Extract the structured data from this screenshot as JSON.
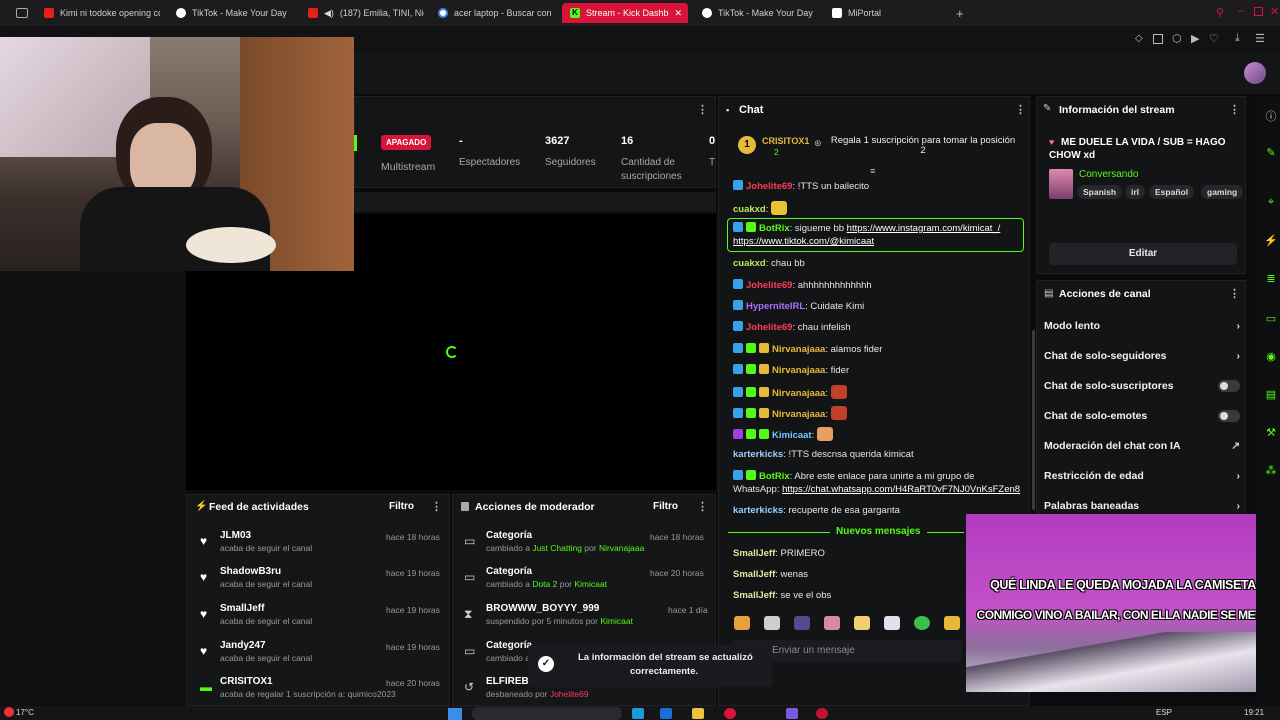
{
  "browser": {
    "tabs": [
      {
        "label": "Kimi ni todoke opening co",
        "icon": "youtube-icon",
        "color": "#e62117"
      },
      {
        "label": "TikTok - Make Your Day",
        "icon": "tiktok-icon",
        "color": "#ffffff"
      },
      {
        "label": "(187) Emilia, TINI, Nic",
        "icon": "youtube-icon",
        "color": "#e62117"
      },
      {
        "label": "acer laptop - Buscar con",
        "icon": "google-icon",
        "color": "#4285f4"
      },
      {
        "label": "Stream - Kick Dashb",
        "icon": "kick-icon",
        "color": "#53fc18",
        "active": true
      },
      {
        "label": "TikTok - Make Your Day",
        "icon": "tiktok-icon",
        "color": "#ffffff"
      },
      {
        "label": "MiPortal",
        "icon": "portal-icon",
        "color": "#ffffff"
      }
    ],
    "new_tab": "+"
  },
  "stats": {
    "status_badge": "APAGADO",
    "multistream": "Multistream",
    "viewers_value": "-",
    "viewers_label": "Espectadores",
    "followers_value": "3627",
    "followers_label": "Seguidores",
    "subs_value": "16",
    "subs_label_1": "Cantidad de",
    "subs_label_2": "suscripciones",
    "extra_value": "0",
    "extra_label": "T"
  },
  "chat": {
    "title": "Chat",
    "pinned_user": "CRISITOX1",
    "pinned_count": "2",
    "pinned_text": "Regala 1 suscripción para tomar la posición 2",
    "pinned_rank": "1",
    "messages": [
      {
        "user": "Johelite69",
        "color": "#ff3b5c",
        "text": ": !TTS un bailecito"
      },
      {
        "user": "cuakxd",
        "color": "#b9e85c",
        "text": ":"
      },
      {
        "user": "BotRix",
        "color": "#53fc18",
        "text": ": sigueme bb ",
        "link": "https://www.instagram.com/kimicat_/"
      },
      {
        "user": "",
        "color": "#ffffff",
        "text": "",
        "link": "https://www.tiktok.com/@kimicaat"
      },
      {
        "user": "cuakxd",
        "color": "#b9e85c",
        "text": ": chau bb"
      },
      {
        "user": "Johelite69",
        "color": "#ff3b5c",
        "text": ": ahhhhhhhhhhhhh"
      },
      {
        "user": "HyperniteIRL",
        "color": "#a970ff",
        "text": ": Cuidate Kimi"
      },
      {
        "user": "Johelite69",
        "color": "#ff3b5c",
        "text": ": chau infelish"
      },
      {
        "user": "Nirvanajaaa",
        "color": "#e6b93a",
        "text": ": alamos fider"
      },
      {
        "user": "Nirvanajaaa",
        "color": "#e6b93a",
        "text": ": fider"
      },
      {
        "user": "Nirvanajaaa",
        "color": "#e6b93a",
        "text": ":"
      },
      {
        "user": "Nirvanajaaa",
        "color": "#e6b93a",
        "text": ":"
      },
      {
        "user": "Kimicaat",
        "color": "#6ec6ff",
        "text": ":"
      },
      {
        "user": "karterkicks",
        "color": "#9ad0ff",
        "text": ": !TTS descnsa querida kimicat"
      },
      {
        "user": "BotRix",
        "color": "#53fc18",
        "text": ": Abre este enlace para unirte a mi grupo de"
      },
      {
        "user": "",
        "color": "#ffffff",
        "text": "WhatsApp: ",
        "link": "https://chat.whatsapp.com/H4RaRT0vF7NJ0VnKsFZen8"
      },
      {
        "user": "karterkicks",
        "color": "#9ad0ff",
        "text": ": recuperte de esa garganta"
      }
    ],
    "new_messages": "Nuevos mensajes",
    "new": [
      {
        "user": "SmallJeff",
        "color": "#e6e6a0",
        "text": ": PRIMERO"
      },
      {
        "user": "SmallJeff",
        "color": "#e6e6a0",
        "text": ": wenas"
      },
      {
        "user": "SmallJeff",
        "color": "#e6e6a0",
        "text": ": se ve el obs"
      }
    ],
    "input_placeholder": "Enviar un mensaje"
  },
  "stream_info": {
    "title": "Información del stream",
    "stream_title": "ME DUELE LA VIDA / SUB = HAGO CHOW xd",
    "category": "Conversando",
    "tags": [
      "Spanish",
      "irl",
      "Español",
      "gaming"
    ],
    "edit_button": "Editar"
  },
  "channel_actions": {
    "title": "Acciones de canal",
    "rows": [
      {
        "label": "Modo lento",
        "control": "chevron"
      },
      {
        "label": "Chat de solo-seguidores",
        "control": "chevron"
      },
      {
        "label": "Chat de solo-suscriptores",
        "control": "toggle"
      },
      {
        "label": "Chat de solo-emotes",
        "control": "toggle"
      },
      {
        "label": "Moderación del chat con IA",
        "control": "external"
      },
      {
        "label": "Restricción de edad",
        "control": "chevron"
      },
      {
        "label": "Palabras baneadas",
        "control": "chevron"
      }
    ]
  },
  "activity_feed": {
    "title": "Feed de actividades",
    "filter": "Filtro",
    "items": [
      {
        "name": "JLM03",
        "sub": "acaba de seguir el canal",
        "time": "hace 18 horas"
      },
      {
        "name": "ShadowB3ru",
        "sub": "acaba de seguir el canal",
        "time": "hace 19 horas"
      },
      {
        "name": "SmallJeff",
        "sub": "acaba de seguir el canal",
        "time": "hace 19 horas"
      },
      {
        "name": "Jandy247",
        "sub": "acaba de seguir el canal",
        "time": "hace 19 horas"
      },
      {
        "name": "CRISITOX1",
        "sub": "acaba de regalar 1 suscripción a: quimico2023",
        "time": "hace 20 horas"
      }
    ]
  },
  "mod_actions": {
    "title": "Acciones de moderador",
    "filter": "Filtro",
    "items": [
      {
        "name": "Categoría",
        "sub_pre": "cambiado a ",
        "sub_hl": "Just Chatting",
        "sub_mid": " por ",
        "sub_user": "Nirvanajaaa",
        "time": "hace 18 horas"
      },
      {
        "name": "Categoría",
        "sub_pre": "cambiado a ",
        "sub_hl": "Dota 2",
        "sub_mid": " por ",
        "sub_user": "Kimicaat",
        "time": "hace 20 horas"
      },
      {
        "name": "BROWWW_BOYYY_999",
        "sub_pre": "suspendido por 5 minutos por ",
        "sub_hl": "",
        "sub_mid": "",
        "sub_user": "Kimicaat",
        "time": "hace 1 día"
      },
      {
        "name": "Categoría",
        "sub_pre": "cambiado a",
        "sub_hl": "",
        "sub_mid": "",
        "sub_user": "",
        "time": ""
      },
      {
        "name": "ELFIREBO",
        "sub_pre": "desbaneado por ",
        "sub_hl": "",
        "sub_mid": "",
        "sub_user": "Johelite69",
        "time": ""
      }
    ]
  },
  "toast": {
    "text_1": "La información del stream se actualizó",
    "text_2": "correctamente."
  },
  "overlay": {
    "line_1": "QUÉ LINDA LE QUEDA MOJADA LA CAMISETA",
    "line_2": "CONMIGO VINO A BAILAR, CON ELLA NADIE SE METE"
  },
  "taskbar": {
    "weather": "17°C",
    "lang": "ESP",
    "time": "19:21"
  }
}
